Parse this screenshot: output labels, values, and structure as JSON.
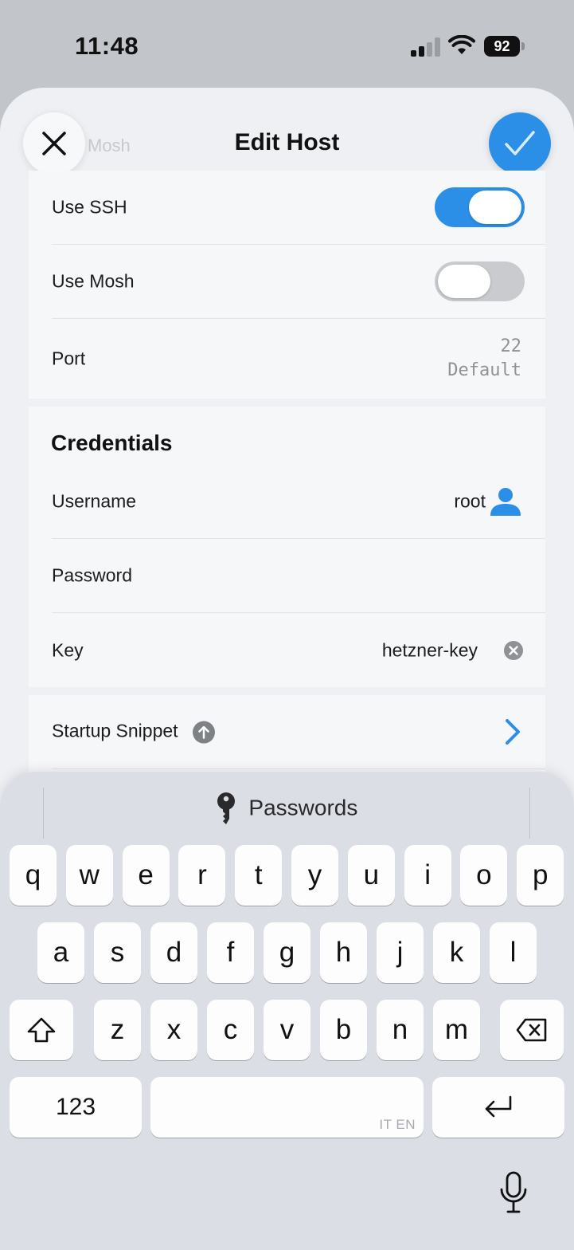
{
  "status_bar": {
    "time": "11:48",
    "battery": "92"
  },
  "sheet": {
    "title": "Edit Host",
    "ghost_label": "Mosh",
    "close_icon": "close-icon",
    "confirm_icon": "checkmark-icon"
  },
  "connection": {
    "use_ssh": {
      "label": "Use SSH",
      "on": true
    },
    "use_mosh": {
      "label": "Use Mosh",
      "on": false
    },
    "port": {
      "label": "Port",
      "value": "22",
      "hint": "Default"
    }
  },
  "credentials": {
    "title": "Credentials",
    "username": {
      "label": "Username",
      "value": "root",
      "icon": "person-icon"
    },
    "password": {
      "label": "Password",
      "value": ""
    },
    "key": {
      "label": "Key",
      "value": "hetzner-key",
      "icon": "clear-icon"
    }
  },
  "startup": {
    "label": "Startup Snippet",
    "info_icon": "arrow-up-circle-icon",
    "chevron_icon": "chevron-right-icon"
  },
  "keyboard": {
    "suggestion": "Passwords",
    "row1": [
      "q",
      "w",
      "e",
      "r",
      "t",
      "y",
      "u",
      "i",
      "o",
      "p"
    ],
    "row2": [
      "a",
      "s",
      "d",
      "f",
      "g",
      "h",
      "j",
      "k",
      "l"
    ],
    "row3": [
      "z",
      "x",
      "c",
      "v",
      "b",
      "n",
      "m"
    ],
    "numbers_key": "123",
    "space_lang": "IT EN",
    "accent_color": "#2b8fe8"
  }
}
